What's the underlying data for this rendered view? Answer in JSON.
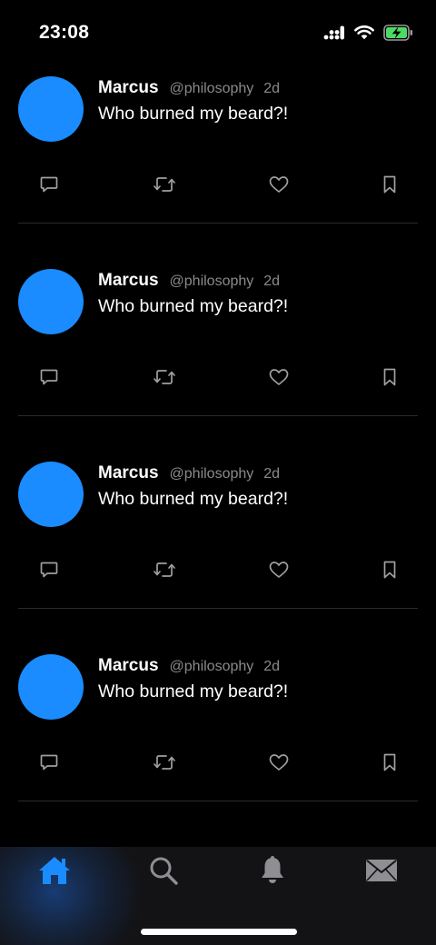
{
  "status_bar": {
    "time": "23:08",
    "icons": [
      "cellular-signal-icon",
      "wifi-icon",
      "battery-charging-icon"
    ],
    "battery_color": "#4cd964"
  },
  "feed": {
    "tweets": [
      {
        "name": "Marcus",
        "handle": "@philosophy",
        "time": "2d",
        "text": "Who burned my beard?!"
      },
      {
        "name": "Marcus",
        "handle": "@philosophy",
        "time": "2d",
        "text": "Who burned my beard?!"
      },
      {
        "name": "Marcus",
        "handle": "@philosophy",
        "time": "2d",
        "text": "Who burned my beard?!"
      },
      {
        "name": "Marcus",
        "handle": "@philosophy",
        "time": "2d",
        "text": "Who burned my beard?!"
      }
    ],
    "action_icons": [
      "reply-icon",
      "retweet-icon",
      "like-icon",
      "bookmark-icon"
    ],
    "avatar_color": "#1a8cff"
  },
  "tab_bar": {
    "tabs": [
      {
        "name": "home",
        "icon": "home-icon",
        "active": true
      },
      {
        "name": "search",
        "icon": "search-icon",
        "active": false
      },
      {
        "name": "notifications",
        "icon": "bell-icon",
        "active": false
      },
      {
        "name": "messages",
        "icon": "mail-icon",
        "active": false
      }
    ],
    "active_color": "#1a8cff",
    "inactive_color": "#8e8e93"
  }
}
